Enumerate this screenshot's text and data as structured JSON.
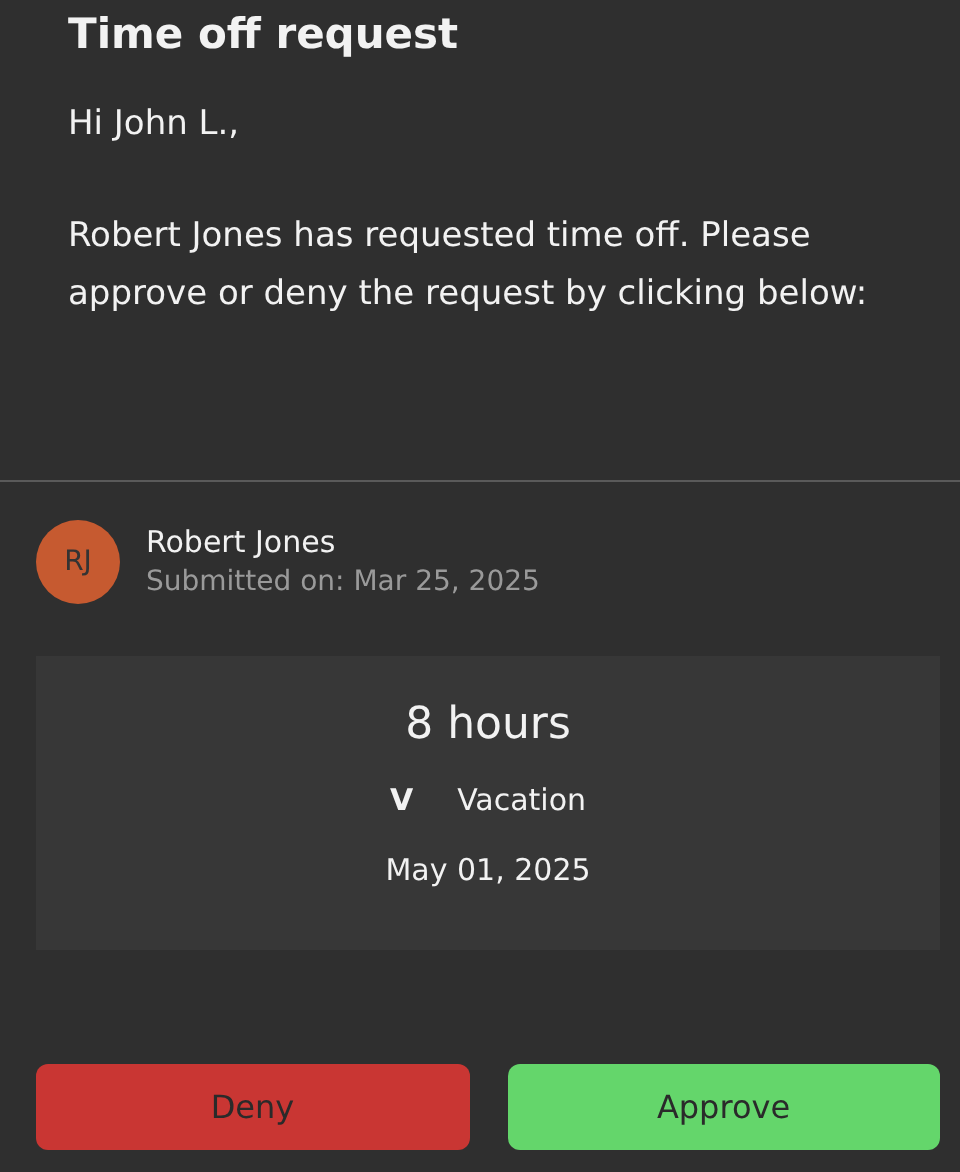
{
  "title": "Time off request",
  "greeting": "Hi John L.,",
  "message": "Robert Jones has requested time off. Please approve or deny the request by clicking below:",
  "requester": {
    "initials": "RJ",
    "name": "Robert Jones",
    "submitted": "Submitted on: Mar 25, 2025"
  },
  "request": {
    "duration": "8 hours",
    "type_code": "V",
    "type": "Vacation",
    "date": "May 01, 2025"
  },
  "buttons": [
    {
      "label": "Deny",
      "kind": "deny"
    },
    {
      "label": "Approve",
      "kind": "approve"
    }
  ]
}
